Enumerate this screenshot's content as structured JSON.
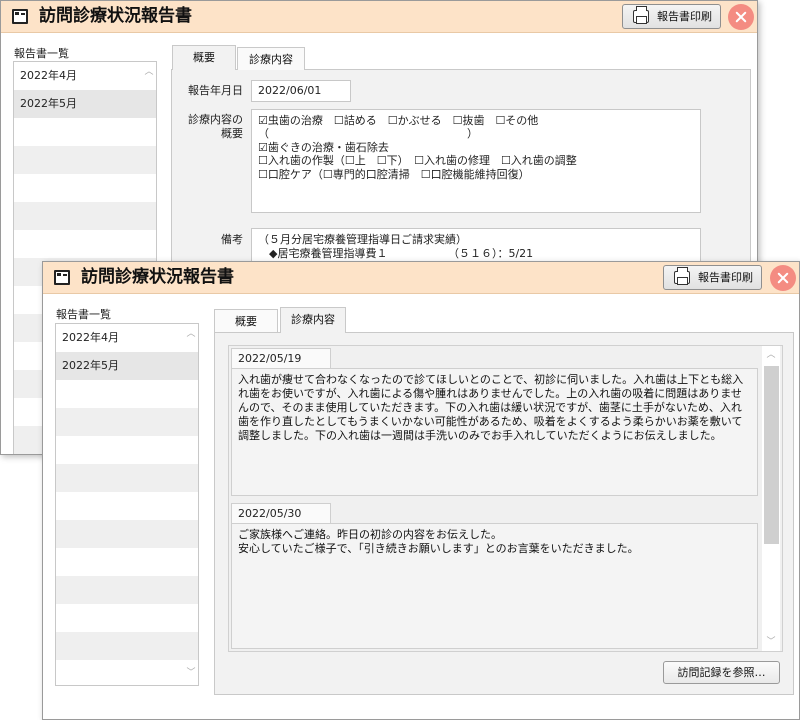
{
  "app": {
    "title": "訪問診療状況報告書",
    "print_label": "報告書印刷",
    "list_label": "報告書一覧",
    "reports": [
      "2022年4月",
      "2022年5月"
    ]
  },
  "back_window": {
    "tabs": [
      "概要",
      "診療内容"
    ],
    "report_date_label": "報告年月日",
    "report_date_value": "2022/06/01",
    "treatment_label_line1": "診療内容の",
    "treatment_label_line2": "概要",
    "treatment_lines": [
      "☑虫歯の治療　☐詰める　☐かぶせる　☐抜歯　☐その他",
      "（　　　　　　　　　　　　　　　　　　）",
      "☑歯ぐきの治療・歯石除去",
      "☐入れ歯の作製（☐上　☐下）　☐入れ歯の修理　☐入れ歯の調整",
      "☐口腔ケア（☐専門的口腔清掃　☐口腔機能維持回復）"
    ],
    "notes_label": "備考",
    "notes_lines": [
      "（５月分居宅療養管理指導日ご請求実績）",
      "　◆居宅療養管理指導費１　　　　　　（５１６）：5/21"
    ]
  },
  "front_window": {
    "tabs": [
      "概要",
      "診療内容"
    ],
    "visits": [
      {
        "date": "2022/05/19",
        "text": "入れ歯が痩せて合わなくなったので診てほしいとのことで、初診に伺いました。入れ歯は上下とも総入れ歯をお使いですが、入れ歯による傷や腫れはありませんでした。上の入れ歯の吸着に問題はありませんので、そのまま使用していただきます。下の入れ歯は緩い状況ですが、歯茎に土手がないため、入れ歯を作り直したとしてもうまくいかない可能性があるため、吸着をよくするよう柔らかいお薬を敷いて調整しました。下の入れ歯は一週間は手洗いのみでお手入れしていただくようにお伝えしました。"
      },
      {
        "date": "2022/05/30",
        "text": "ご家族様へご連絡。昨日の初診の内容をお伝えした。\n安心していたご様子で、「引き続きお願いします」とのお言葉をいただきました。"
      }
    ],
    "ref_button_label": "訪問記録を参照…"
  },
  "colors": {
    "titlebar": "#fde3c8",
    "close": "#f48c82",
    "panel": "#f2f2f2"
  }
}
